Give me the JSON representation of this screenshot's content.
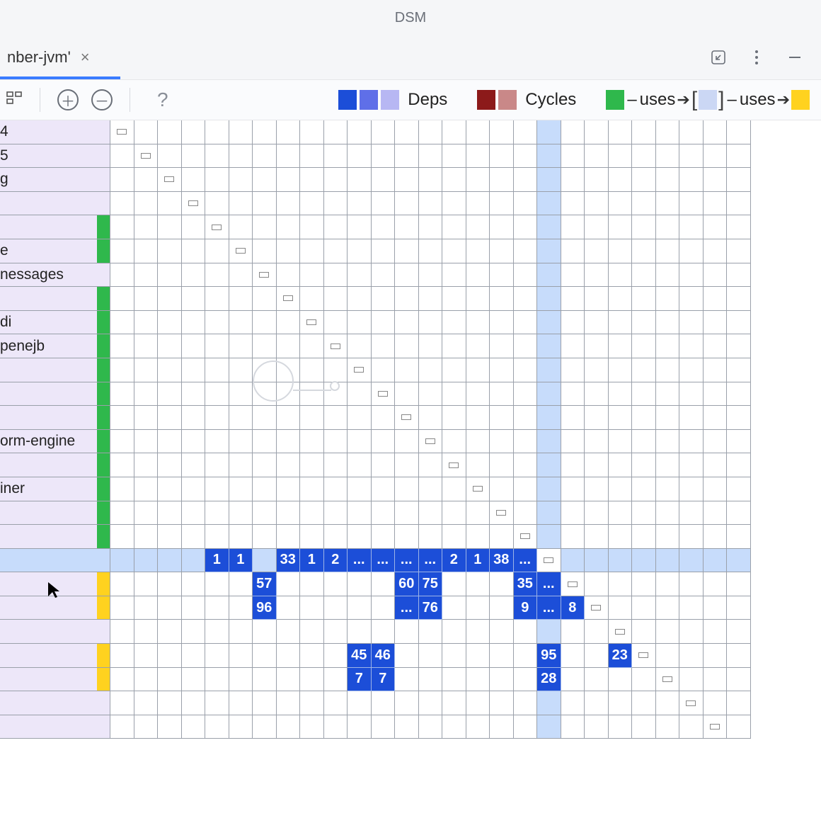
{
  "window": {
    "title": "DSM"
  },
  "tab": {
    "label": "nber-jvm'",
    "close_glyph": "×"
  },
  "toolbar": {
    "plus": "＋",
    "minus": "－",
    "help": "?"
  },
  "legend": {
    "deps_label": "Deps",
    "cycles_label": "Cycles",
    "uses1": "uses",
    "uses2": "uses",
    "colors": {
      "deps": [
        "#1c4ed8",
        "#5f6fe8",
        "#b7b7f3"
      ],
      "cycles": [
        "#8c1a1a",
        "#c98888"
      ],
      "uses_src": "#2fb84c",
      "bracket_bg": "#cbd7f4",
      "uses_dst": "#ffd21f"
    }
  },
  "rows": [
    {
      "label": "4",
      "chip": null
    },
    {
      "label": "5",
      "chip": null
    },
    {
      "label": "g",
      "chip": null
    },
    {
      "label": "",
      "chip": null
    },
    {
      "label": "",
      "chip": "#2fb84c"
    },
    {
      "label": "e",
      "chip": "#2fb84c"
    },
    {
      "label": "nessages",
      "chip": null
    },
    {
      "label": "",
      "chip": "#2fb84c"
    },
    {
      "label": "di",
      "chip": "#2fb84c"
    },
    {
      "label": "penejb",
      "chip": "#2fb84c"
    },
    {
      "label": "",
      "chip": "#2fb84c"
    },
    {
      "label": "",
      "chip": "#2fb84c"
    },
    {
      "label": "",
      "chip": "#2fb84c"
    },
    {
      "label": "orm-engine",
      "chip": "#2fb84c"
    },
    {
      "label": "",
      "chip": "#2fb84c"
    },
    {
      "label": "iner",
      "chip": "#2fb84c"
    },
    {
      "label": "",
      "chip": "#2fb84c"
    },
    {
      "label": "",
      "chip": "#2fb84c"
    },
    {
      "label": "",
      "chip": null,
      "selected": true
    },
    {
      "label": "",
      "chip": "#ffd21f"
    },
    {
      "label": "",
      "chip": "#ffd21f"
    },
    {
      "label": "",
      "chip": null
    },
    {
      "label": "",
      "chip": "#ffd21f"
    },
    {
      "label": "",
      "chip": "#ffd21f"
    },
    {
      "label": "",
      "chip": null
    },
    {
      "label": "",
      "chip": null
    }
  ],
  "cols": 27,
  "diagonal": true,
  "highlight_col": 18,
  "cells": {
    "r18": [
      {
        "c": 4,
        "v": "1"
      },
      {
        "c": 5,
        "v": "1"
      },
      {
        "c": 7,
        "v": "33"
      },
      {
        "c": 8,
        "v": "1"
      },
      {
        "c": 9,
        "v": "2"
      },
      {
        "c": 10,
        "v": "..."
      },
      {
        "c": 11,
        "v": "..."
      },
      {
        "c": 12,
        "v": "..."
      },
      {
        "c": 13,
        "v": "..."
      },
      {
        "c": 14,
        "v": "2"
      },
      {
        "c": 15,
        "v": "1"
      },
      {
        "c": 16,
        "v": "38"
      },
      {
        "c": 17,
        "v": "..."
      }
    ],
    "r19": [
      {
        "c": 6,
        "v": "57"
      },
      {
        "c": 12,
        "v": "60"
      },
      {
        "c": 13,
        "v": "75"
      },
      {
        "c": 17,
        "v": "35"
      },
      {
        "c": 18,
        "v": "..."
      }
    ],
    "r20": [
      {
        "c": 6,
        "v": "96"
      },
      {
        "c": 12,
        "v": "..."
      },
      {
        "c": 13,
        "v": "76"
      },
      {
        "c": 17,
        "v": "9"
      },
      {
        "c": 18,
        "v": "..."
      },
      {
        "c": 19,
        "v": "8"
      }
    ],
    "r22": [
      {
        "c": 10,
        "v": "45"
      },
      {
        "c": 11,
        "v": "46"
      },
      {
        "c": 18,
        "v": "95"
      },
      {
        "c": 21,
        "v": "23"
      }
    ],
    "r23": [
      {
        "c": 10,
        "v": "7"
      },
      {
        "c": 11,
        "v": "7"
      },
      {
        "c": 18,
        "v": "28"
      }
    ]
  }
}
